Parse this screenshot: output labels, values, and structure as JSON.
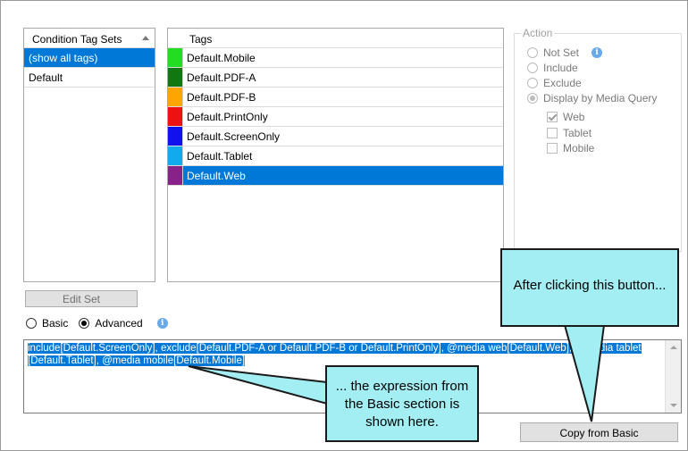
{
  "condition_tag_sets": {
    "header": "Condition Tag Sets",
    "items": [
      {
        "label": "(show all tags)",
        "selected": true
      },
      {
        "label": "Default",
        "selected": false
      }
    ]
  },
  "tags": {
    "header": "Tags",
    "items": [
      {
        "label": "Default.Mobile",
        "color": "#22dd22",
        "selected": false
      },
      {
        "label": "Default.PDF-A",
        "color": "#117711",
        "selected": false
      },
      {
        "label": "Default.PDF-B",
        "color": "#ffa500",
        "selected": false
      },
      {
        "label": "Default.PrintOnly",
        "color": "#ee1111",
        "selected": false
      },
      {
        "label": "Default.ScreenOnly",
        "color": "#1111ee",
        "selected": false
      },
      {
        "label": "Default.Tablet",
        "color": "#11aaee",
        "selected": false
      },
      {
        "label": "Default.Web",
        "color": "#882288",
        "selected": true
      }
    ]
  },
  "action": {
    "title": "Action",
    "options": [
      {
        "label": "Not Set",
        "checked": false
      },
      {
        "label": "Include",
        "checked": false
      },
      {
        "label": "Exclude",
        "checked": false
      },
      {
        "label": "Display by Media Query",
        "checked": true
      }
    ],
    "media": [
      {
        "label": "Web",
        "checked": true
      },
      {
        "label": "Tablet",
        "checked": false
      },
      {
        "label": "Mobile",
        "checked": false
      }
    ]
  },
  "edit_set_label": "Edit Set",
  "mode": {
    "basic": "Basic",
    "advanced": "Advanced",
    "selected": "advanced"
  },
  "expression": {
    "line1": "include[Default.ScreenOnly], exclude[Default.PDF-A or Default.PDF-B or Default.PrintOnly], @media web[Default.Web], @media tablet",
    "line2": "[Default.Tablet], @media mobile[Default.Mobile]"
  },
  "copy_from_basic_label": "Copy from Basic",
  "callouts": {
    "button_note": "After clicking this button...",
    "expression_note_1": "... the expression from",
    "expression_note_2": "the Basic section is",
    "expression_note_3": "shown here."
  },
  "colors": {
    "selection": "#0078d7",
    "callout_fill": "#a3eef2"
  }
}
